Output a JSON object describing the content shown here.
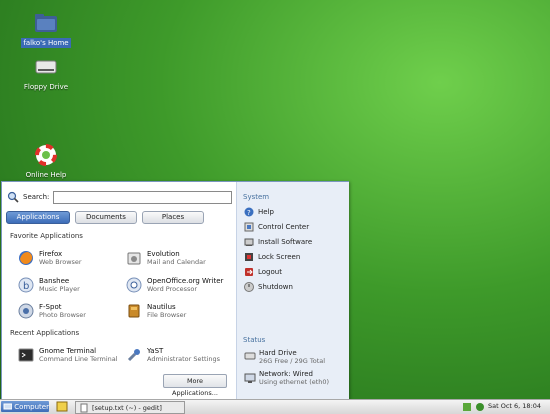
{
  "desktop": {
    "icons": [
      {
        "label": "falko's Home",
        "selected": true,
        "icon": "folder-home-icon"
      },
      {
        "label": "Floppy Drive",
        "icon": "floppy-drive-icon"
      },
      {
        "label": "Online Help",
        "icon": "help-lifebuoy-icon"
      }
    ]
  },
  "menu": {
    "search_label": "Search:",
    "search_value": "",
    "tabs": [
      "Applications",
      "Documents",
      "Places"
    ],
    "active_tab": "Applications",
    "favorites_title": "Favorite Applications",
    "favorites": [
      {
        "name": "Firefox",
        "desc": "Web Browser"
      },
      {
        "name": "Evolution",
        "desc": "Mail and Calendar"
      },
      {
        "name": "Banshee",
        "desc": "Music Player"
      },
      {
        "name": "OpenOffice.org Writer",
        "desc": "Word Processor"
      },
      {
        "name": "F-Spot",
        "desc": "Photo Browser"
      },
      {
        "name": "Nautilus",
        "desc": "File Browser"
      }
    ],
    "recent_title": "Recent Applications",
    "recent": [
      {
        "name": "Gnome Terminal",
        "desc": "Command Line Terminal"
      },
      {
        "name": "YaST",
        "desc": "Administrator Settings"
      }
    ],
    "more_button": "More Applications...",
    "system_title": "System",
    "system_items": [
      "Help",
      "Control Center",
      "Install Software",
      "Lock Screen",
      "Logout",
      "Shutdown"
    ],
    "status_title": "Status",
    "status_items": [
      {
        "name": "Hard Drive",
        "desc": "26G Free / 29G Total"
      },
      {
        "name": "Network: Wired",
        "desc": "Using ethernet (eth0)"
      }
    ]
  },
  "taskbar": {
    "computer_label": "Computer",
    "task_label": "[setup.txt (~) - gedit]",
    "clock": "Sat Oct 6, 18:04"
  },
  "colors": {
    "accent": "#3d6db8",
    "desktop": "#3e9a2a"
  }
}
